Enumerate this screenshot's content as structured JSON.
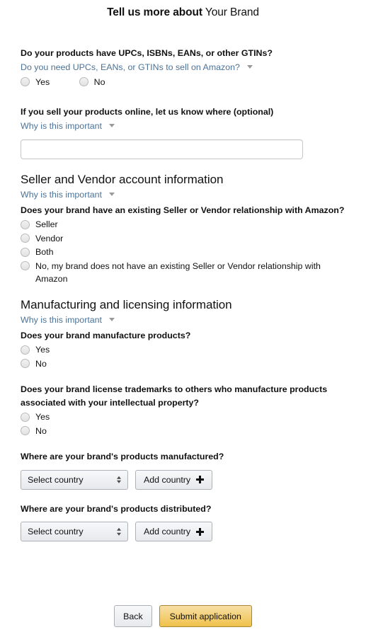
{
  "title": {
    "bold_part": "Tell us more about",
    "regular_part": "Your Brand"
  },
  "gtin": {
    "question": "Do your products have UPCs, ISBNs, EANs, or other GTINs?",
    "help_link": "Do you need UPCs, EANs, or GTINs to sell on Amazon?",
    "options": [
      "Yes",
      "No"
    ]
  },
  "online_sales": {
    "question": "If you sell your products online, let us know where (optional)",
    "help_link": "Why is this important",
    "input_value": "",
    "input_placeholder": ""
  },
  "seller_vendor": {
    "heading": "Seller and Vendor account information",
    "help_link": "Why is this important",
    "question": "Does your brand have an existing Seller or Vendor relationship with Amazon?",
    "options": [
      "Seller",
      "Vendor",
      "Both",
      "No, my brand does not have an existing Seller or Vendor relationship with Amazon"
    ]
  },
  "manufacturing": {
    "heading": "Manufacturing and licensing information",
    "help_link": "Why is this important",
    "manufacture_question": "Does your brand manufacture products?",
    "manufacture_options": [
      "Yes",
      "No"
    ],
    "license_question": "Does your brand license trademarks to others who manufacture products associated with your intellectual property?",
    "license_options": [
      "Yes",
      "No"
    ],
    "manufactured_where_label": "Where are your brand's products manufactured?",
    "distributed_where_label": "Where are your brand's products distributed?",
    "select_placeholder": "Select country",
    "add_country_label": "Add country"
  },
  "footer": {
    "back_label": "Back",
    "submit_label": "Submit application"
  },
  "colors": {
    "link": "#4c7397",
    "submit_gradient_top": "#f7dfa5",
    "submit_gradient_bottom": "#f0c14b",
    "submit_border": "#a88734",
    "text": "#111111",
    "input_border": "#c6c6c6",
    "control_border": "#adb1b8"
  }
}
